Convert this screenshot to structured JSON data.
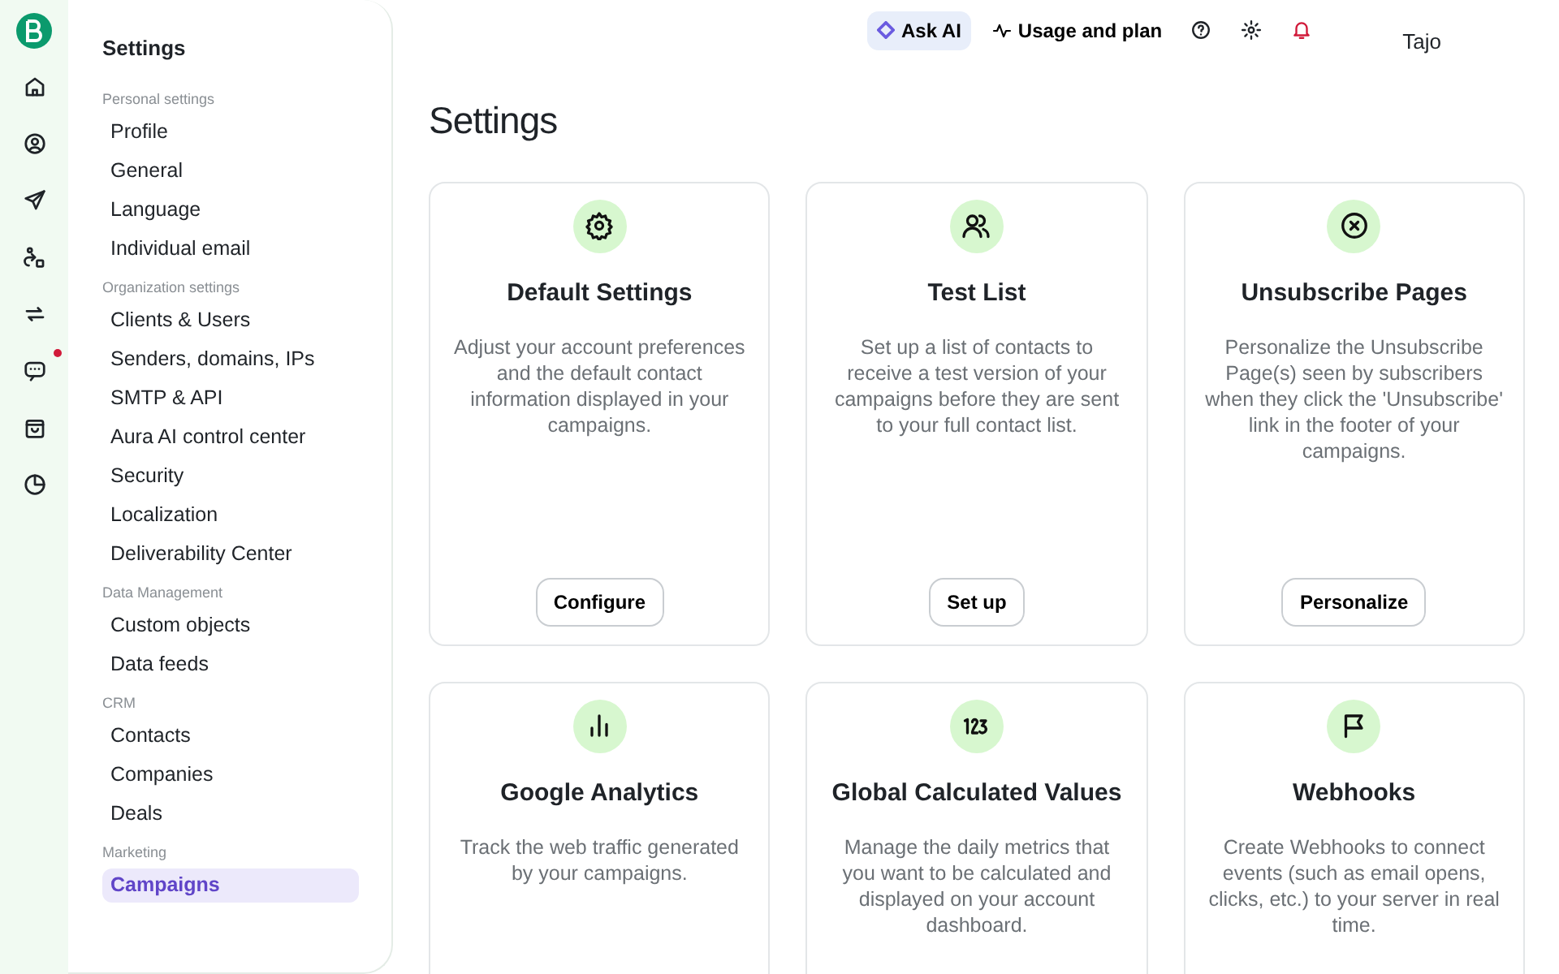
{
  "rail": [
    {
      "kind": "logo",
      "notification": false
    },
    {
      "kind": "home",
      "notification": false
    },
    {
      "kind": "contacts",
      "notification": false
    },
    {
      "kind": "send",
      "notification": false
    },
    {
      "kind": "automation",
      "notification": false
    },
    {
      "kind": "sync",
      "notification": false
    },
    {
      "kind": "chat",
      "notification": true
    },
    {
      "kind": "shop",
      "notification": false
    },
    {
      "kind": "report",
      "notification": false
    }
  ],
  "sidebar": {
    "title": "Settings",
    "sections": [
      {
        "heading": "Personal settings",
        "items": [
          {
            "label": "Profile",
            "selected": false
          },
          {
            "label": "General",
            "selected": false
          },
          {
            "label": "Language",
            "selected": false
          },
          {
            "label": "Individual email",
            "selected": false
          }
        ]
      },
      {
        "heading": "Organization settings",
        "items": [
          {
            "label": "Clients & Users",
            "selected": false
          },
          {
            "label": "Senders, domains, IPs",
            "selected": false
          },
          {
            "label": "SMTP & API",
            "selected": false
          },
          {
            "label": "Aura AI control center",
            "selected": false
          },
          {
            "label": "Security",
            "selected": false
          },
          {
            "label": "Localization",
            "selected": false
          },
          {
            "label": "Deliverability Center",
            "selected": false
          }
        ]
      },
      {
        "heading": "Data Management",
        "items": [
          {
            "label": "Custom objects",
            "selected": false
          },
          {
            "label": "Data feeds",
            "selected": false
          }
        ]
      },
      {
        "heading": "CRM",
        "items": [
          {
            "label": "Contacts",
            "selected": false
          },
          {
            "label": "Companies",
            "selected": false
          },
          {
            "label": "Deals",
            "selected": false
          }
        ]
      },
      {
        "heading": "Marketing",
        "items": [
          {
            "label": "Campaigns",
            "selected": true
          }
        ]
      }
    ]
  },
  "topbar": {
    "ask_ai": "Ask AI",
    "usage": "Usage and plan",
    "user": "Tajo"
  },
  "page_title": "Settings",
  "cards": [
    {
      "kind": "gear",
      "title": "Default Settings",
      "description": "Adjust your account preferences and the default contact information displayed in your campaigns.",
      "button": "Configure"
    },
    {
      "kind": "users",
      "title": "Test List",
      "description": "Set up a list of contacts to receive a test version of your campaigns before they are sent to your full contact list.",
      "button": "Set up"
    },
    {
      "kind": "xcircle",
      "title": "Unsubscribe Pages",
      "description": "Personalize the Unsubscribe Page(s) seen by subscribers when they click the 'Unsubscribe' link in the footer of your campaigns.",
      "button": "Personalize"
    },
    {
      "kind": "bars",
      "title": "Google Analytics",
      "description": "Track the web traffic generated by your campaigns."
    },
    {
      "kind": "numbers",
      "title": "Global Calculated Values",
      "description": "Manage the daily metrics that you want to be calculated and displayed on your account dashboard."
    },
    {
      "kind": "flag",
      "title": "Webhooks",
      "description": "Create Webhooks to connect events (such as email opens, clicks, etc.) to your server in real time."
    }
  ]
}
